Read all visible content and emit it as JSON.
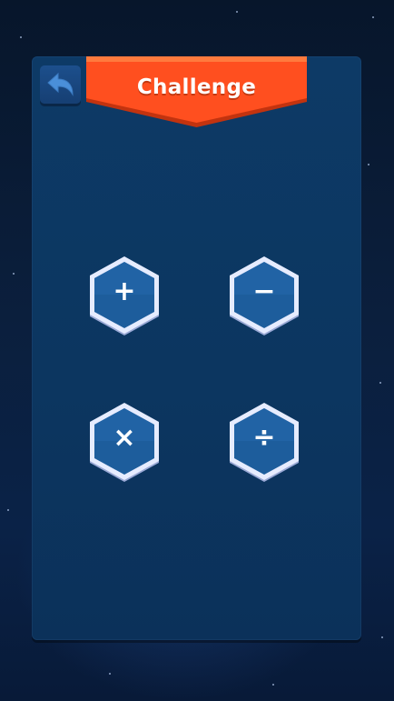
{
  "header": {
    "title": "Challenge",
    "back_icon": "back-arrow-icon"
  },
  "operations": [
    {
      "name": "addition",
      "symbol": "+"
    },
    {
      "name": "subtraction",
      "symbol": "−"
    },
    {
      "name": "multiplication",
      "symbol": "×"
    },
    {
      "name": "division",
      "symbol": "÷"
    }
  ],
  "colors": {
    "banner": "#ff4f1f",
    "panel": "#0c3660",
    "hex_fill": "#1d5d9c",
    "hex_border": "#e6ecff",
    "back_button": "#1c4f8c"
  }
}
